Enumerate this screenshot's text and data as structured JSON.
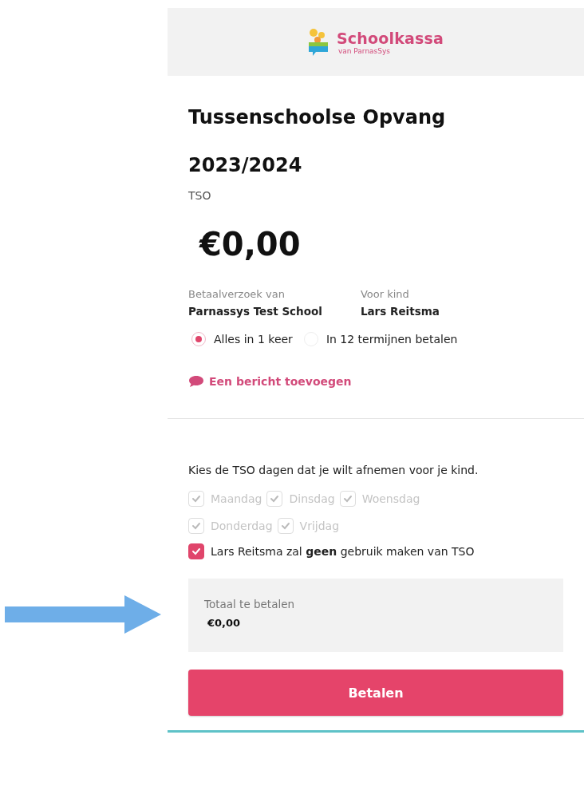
{
  "header": {
    "brand": "Schoolkassa",
    "tagline": "van ParnasSys"
  },
  "title": "Tussenschoolse Opvang 2023/2024",
  "category": "TSO",
  "amount": "€0,00",
  "info": [
    {
      "label": "Betaalverzoek van",
      "value": "Parnassys Test School"
    },
    {
      "label": "Voor kind",
      "value": "Lars Reitsma"
    }
  ],
  "payment_options": [
    {
      "label": "Alles in 1 keer",
      "selected": true
    },
    {
      "label": "In 12 termijnen betalen",
      "selected": false
    }
  ],
  "message_link": "Een bericht toevoegen",
  "instruction": "Kies de TSO dagen dat je wilt afnemen voor je kind.",
  "days": [
    {
      "label": "Maandag",
      "checked": true,
      "disabled": true
    },
    {
      "label": "Dinsdag",
      "checked": true,
      "disabled": true
    },
    {
      "label": "Woensdag",
      "checked": true,
      "disabled": true
    },
    {
      "label": "Donderdag",
      "checked": true,
      "disabled": true
    },
    {
      "label": "Vrijdag",
      "checked": true,
      "disabled": true
    }
  ],
  "opt_out": {
    "label": "Lars Reitsma zal **geen** gebruik maken van TSO",
    "checked": true,
    "disabled": false
  },
  "total": {
    "label": "Totaal te betalen",
    "value": "€0,00"
  },
  "pay_button": "Betalen"
}
